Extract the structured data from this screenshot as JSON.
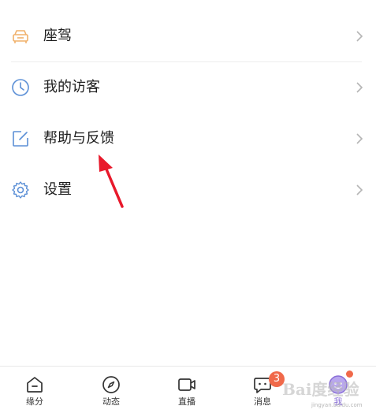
{
  "menu": {
    "items": [
      {
        "label": "座驾",
        "icon": "car-seat-icon"
      },
      {
        "label": "我的访客",
        "icon": "clock-icon"
      },
      {
        "label": "帮助与反馈",
        "icon": "edit-icon"
      },
      {
        "label": "设置",
        "icon": "gear-icon"
      }
    ]
  },
  "tabbar": {
    "tabs": [
      {
        "label": "缘分",
        "icon": "home-icon"
      },
      {
        "label": "动态",
        "icon": "compass-icon"
      },
      {
        "label": "直播",
        "icon": "video-camera-icon"
      },
      {
        "label": "消息",
        "icon": "chat-bubble-icon"
      },
      {
        "label": "我",
        "icon": "avatar-icon"
      }
    ],
    "messages_badge": "3"
  },
  "watermark": {
    "text": "Bai度经验",
    "sub": "jingyan.baidu.com"
  },
  "colors": {
    "car_icon": "#f0b06a",
    "menu_icon": "#5b8fd6",
    "chevron": "#b5b5b5",
    "arrow": "#e8192b",
    "badge": "#f0694a",
    "active_tab": "#8a6fd8"
  }
}
